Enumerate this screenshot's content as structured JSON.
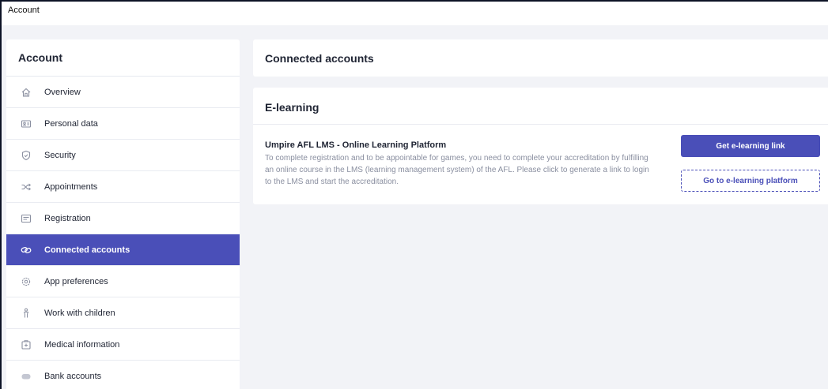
{
  "window": {
    "title": "Account"
  },
  "sidebar": {
    "header": "Account",
    "items": [
      {
        "label": "Overview",
        "icon": "home-icon"
      },
      {
        "label": "Personal data",
        "icon": "id-card-icon"
      },
      {
        "label": "Security",
        "icon": "shield-icon"
      },
      {
        "label": "Appointments",
        "icon": "shuffle-icon"
      },
      {
        "label": "Registration",
        "icon": "form-icon"
      },
      {
        "label": "Connected accounts",
        "icon": "link-icon",
        "active": true
      },
      {
        "label": "App preferences",
        "icon": "settings-icon"
      },
      {
        "label": "Work with children",
        "icon": "child-icon"
      },
      {
        "label": "Medical information",
        "icon": "medical-icon"
      },
      {
        "label": "Bank accounts",
        "icon": "bank-icon"
      }
    ]
  },
  "main": {
    "connected_heading": "Connected accounts",
    "elearning": {
      "heading": "E-learning",
      "item_title": "Umpire AFL LMS - Online Learning Platform",
      "item_desc": "To complete registration and to be appointable for games, you need to complete your accreditation by fulfilling an online course in the LMS (learning management system) of the AFL. Please click to generate a link to login to the LMS and start the accreditation.",
      "get_link_label": "Get e-learning link",
      "go_platform_label": "Go to e-learning platform"
    }
  },
  "colors": {
    "accent": "#4a4fb8",
    "background": "#f2f3f7",
    "muted_text": "#8a8fa0"
  }
}
